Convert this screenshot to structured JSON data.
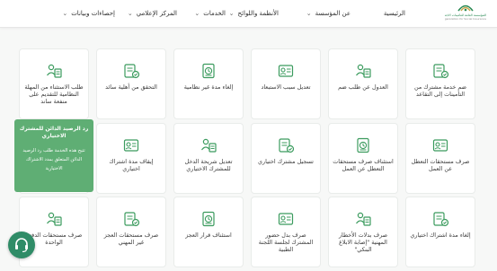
{
  "header": {
    "logo_text_ar": "المؤسسة العامة للتأمينات الاجتماعية",
    "logo_text_en": "General Organization for Social Insurance",
    "nav": [
      {
        "label": "الرئيسية",
        "has_dropdown": false
      },
      {
        "label": "عن المؤسسة",
        "has_dropdown": true
      },
      {
        "label": "الأنظمة واللوائح",
        "has_dropdown": true
      },
      {
        "label": "الخدمات",
        "has_dropdown": true
      },
      {
        "label": "المركز الإعلامي",
        "has_dropdown": true
      },
      {
        "label": "إحصاءات وبيانات",
        "has_dropdown": true
      }
    ]
  },
  "services": [
    {
      "label": "ضم خدمة مشترك من التأمينات إلى التقاعد",
      "icon": "transfer-person-icon"
    },
    {
      "label": "العدول عن طلب ضم",
      "icon": "withdraw-request-icon"
    },
    {
      "label": "تعديل سبب الاستبعاد",
      "icon": "edit-reason-icon"
    },
    {
      "label": "إلغاء مدة غير نظامية",
      "icon": "cancel-period-icon"
    },
    {
      "label": "التحقق من أهلية سائد",
      "icon": "eligibility-check-icon"
    },
    {
      "label": "طلب الاستثناء من المهلة النظامية للتقديم على منفعة ساند",
      "icon": "exemption-request-icon"
    },
    {
      "label": "صرف مستحقات التعطل عن العمل",
      "icon": "unemployment-benefit-icon"
    },
    {
      "label": "استئناف صرف مستحقات التعطل عن العمل",
      "icon": "resume-benefit-icon"
    },
    {
      "label": "تسجيل مشترك اختياري",
      "icon": "register-subscriber-icon"
    },
    {
      "label": "تعديل شريحة الدخل للمشترك الاختياري",
      "icon": "income-bracket-icon"
    },
    {
      "label": "إيقاف مدة اشتراك اختياري",
      "icon": "stop-subscription-icon"
    },
    {
      "label": "",
      "icon": "service-icon"
    },
    {
      "label": "إلغاء مدة اشتراك اختياري",
      "icon": "cancel-subscription-icon"
    },
    {
      "label": "صرف بدلات الأخطار المهنية \"إصابة الابلاغ البنكي\"",
      "icon": "occupational-hazard-icon"
    },
    {
      "label": "صرف بدل حضور المشترك لجلسة اللجنة الطبية",
      "icon": "medical-committee-icon"
    },
    {
      "label": "استئناف قرار العجز",
      "icon": "disability-appeal-icon"
    },
    {
      "label": "صرف مستحقات العجز غير المهني",
      "icon": "disability-benefit-icon"
    },
    {
      "label": "صرف مستحقات الدفعة الواحدة",
      "icon": "lump-sum-icon"
    }
  ],
  "tooltip": {
    "title": "رد الرصيد الدائن للمشترك الاختياري",
    "body": "تتيح هذه الخدمة طلب رد الرصيد الدائن المتعلق بمدد الاشتراك الاختيارية"
  },
  "chat": {
    "icon": "chat-support-icon"
  },
  "colors": {
    "accent": "#2f8c67",
    "tooltip_bg": "#5fae74",
    "icon": "#3b9b5e"
  }
}
